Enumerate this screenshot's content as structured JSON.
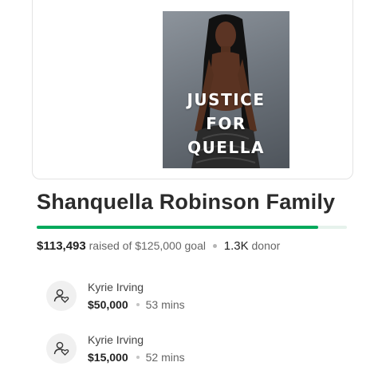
{
  "campaign": {
    "poster_lines": [
      "JUSTICE",
      "FOR",
      "QUELLA"
    ],
    "title": "Shanquella Robinson Family",
    "raised": "$113,493",
    "raised_text": "raised of $125,000 goal",
    "donor_count": "1.3K",
    "donor_label": "donor",
    "progress_percent": 90.8,
    "accent_color": "#02a95c"
  },
  "donations": [
    {
      "name": "Kyrie Irving",
      "amount": "$50,000",
      "time": "53 mins",
      "icon": "donor-heart-person-icon"
    },
    {
      "name": "Kyrie Irving",
      "amount": "$15,000",
      "time": "52 mins",
      "icon": "donor-heart-person-icon"
    }
  ]
}
